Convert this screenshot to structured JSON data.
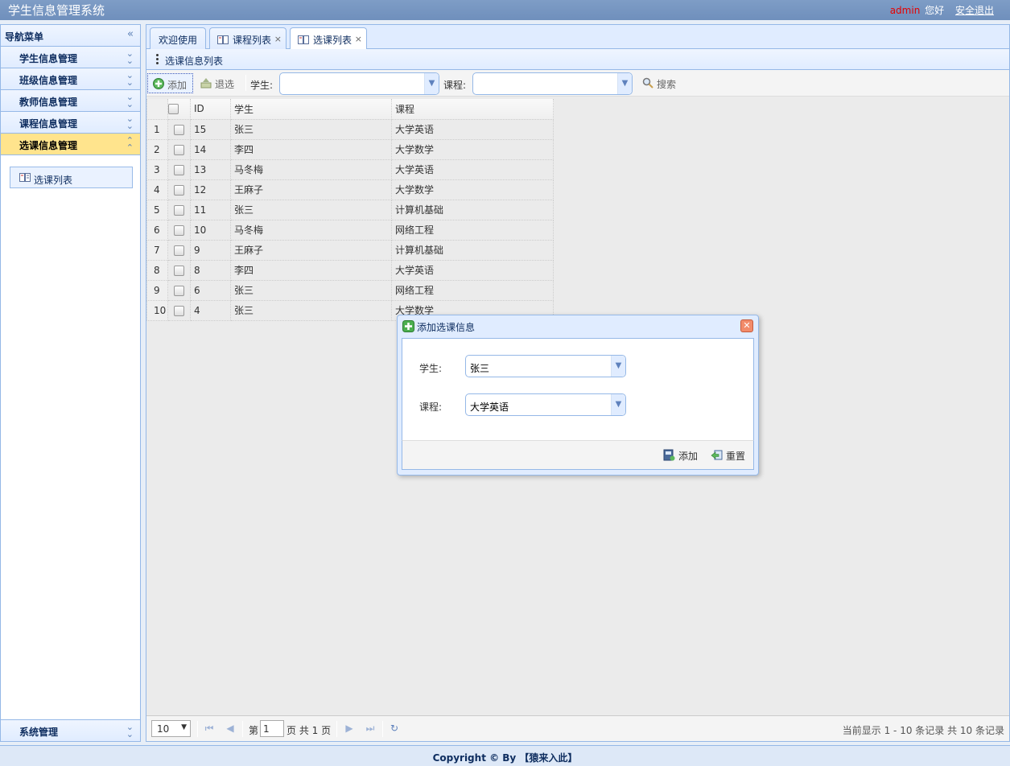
{
  "header": {
    "app_title": "学生信息管理系统",
    "username": "admin",
    "greeting": "您好",
    "logout": "安全退出"
  },
  "sidebar": {
    "title": "导航菜单",
    "sections": [
      {
        "label": "学生信息管理",
        "expanded": false
      },
      {
        "label": "班级信息管理",
        "expanded": false
      },
      {
        "label": "教师信息管理",
        "expanded": false
      },
      {
        "label": "课程信息管理",
        "expanded": false
      },
      {
        "label": "选课信息管理",
        "expanded": true
      }
    ],
    "active_sub_item": "选课列表",
    "bottom_section": "系统管理"
  },
  "tabs": [
    {
      "label": "欢迎使用",
      "closable": false,
      "selected": false
    },
    {
      "label": "课程列表",
      "closable": true,
      "selected": false
    },
    {
      "label": "选课列表",
      "closable": true,
      "selected": true
    }
  ],
  "panel": {
    "title": "选课信息列表"
  },
  "toolbar": {
    "add_label": "添加",
    "drop_label": "退选",
    "student_label": "学生:",
    "course_label": "课程:",
    "student_value": "",
    "course_value": "",
    "search_label": "搜索"
  },
  "grid": {
    "columns": [
      "ID",
      "学生",
      "课程"
    ],
    "rows": [
      {
        "n": "1",
        "id": "15",
        "student": "张三",
        "course": "大学英语"
      },
      {
        "n": "2",
        "id": "14",
        "student": "李四",
        "course": "大学数学"
      },
      {
        "n": "3",
        "id": "13",
        "student": "马冬梅",
        "course": "大学英语"
      },
      {
        "n": "4",
        "id": "12",
        "student": "王麻子",
        "course": "大学数学"
      },
      {
        "n": "5",
        "id": "11",
        "student": "张三",
        "course": "计算机基础"
      },
      {
        "n": "6",
        "id": "10",
        "student": "马冬梅",
        "course": "网络工程"
      },
      {
        "n": "7",
        "id": "9",
        "student": "王麻子",
        "course": "计算机基础"
      },
      {
        "n": "8",
        "id": "8",
        "student": "李四",
        "course": "大学英语"
      },
      {
        "n": "9",
        "id": "6",
        "student": "张三",
        "course": "网络工程"
      },
      {
        "n": "10",
        "id": "4",
        "student": "张三",
        "course": "大学数学"
      }
    ]
  },
  "pager": {
    "page_size": "10",
    "page_prefix": "第",
    "page_number": "1",
    "page_suffix": "页 共 1 页",
    "info": "当前显示 1 - 10 条记录 共 10 条记录"
  },
  "dialog": {
    "title": "添加选课信息",
    "student_label": "学生:",
    "student_value": "张三",
    "course_label": "课程:",
    "course_value": "大学英语",
    "add_button": "添加",
    "reset_button": "重置"
  },
  "footer": {
    "copyright": "Copyright © By 【猿来入此】"
  },
  "colors": {
    "header_bg": "#7e9dc6",
    "border": "#95b8e7",
    "active_menu": "#ffe48d",
    "username": "#e60000"
  }
}
